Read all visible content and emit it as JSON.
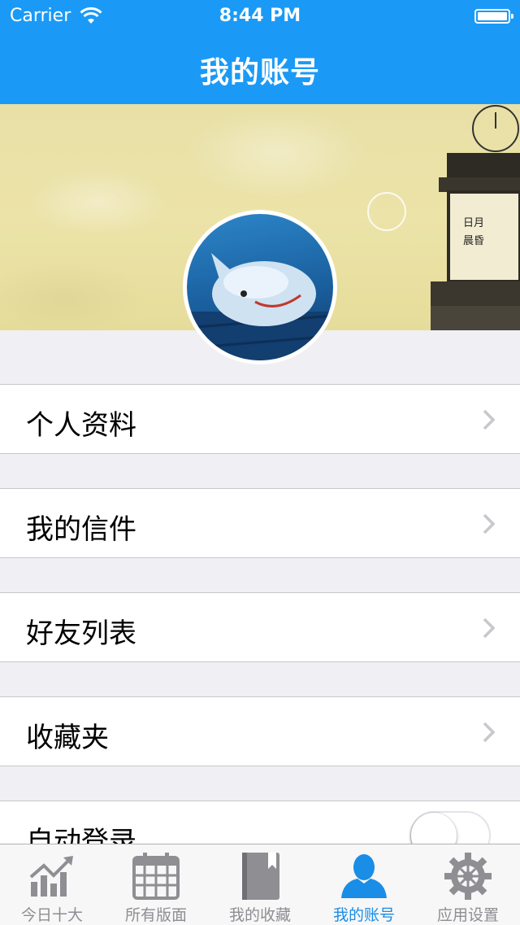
{
  "status_bar": {
    "carrier": "Carrier",
    "time": "8:44 PM"
  },
  "nav": {
    "title": "我的账号"
  },
  "menu": {
    "profile": "个人资料",
    "letters": "我的信件",
    "friends": "好友列表",
    "favorites": "收藏夹",
    "auto_login": "自动登录"
  },
  "auto_login_enabled": false,
  "tabs": [
    {
      "label": "今日十大",
      "icon": "chart-icon"
    },
    {
      "label": "所有版面",
      "icon": "calendar-icon"
    },
    {
      "label": "我的收藏",
      "icon": "book-icon"
    },
    {
      "label": "我的账号",
      "icon": "user-icon"
    },
    {
      "label": "应用设置",
      "icon": "gear-icon"
    }
  ],
  "active_tab": "我的账号",
  "colors": {
    "accent": "#1a9af6",
    "active_tab": "#1a8de6",
    "inactive_tab": "#8e8e93"
  }
}
